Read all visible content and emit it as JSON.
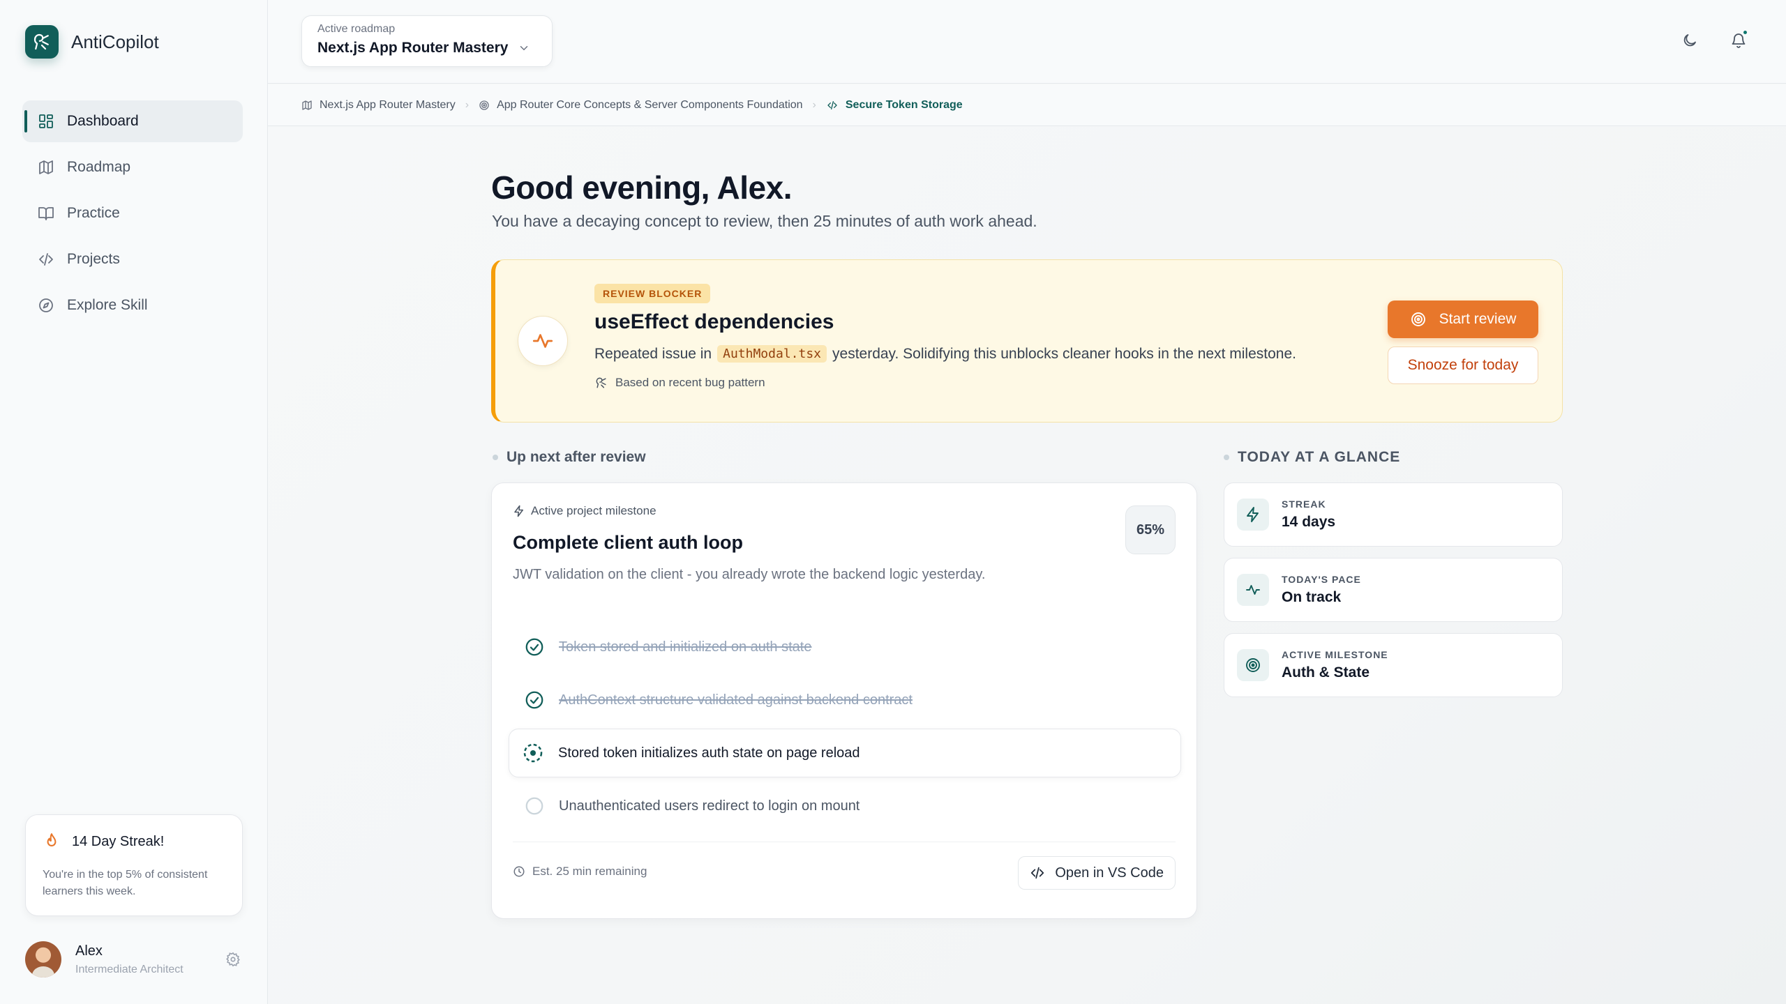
{
  "app": {
    "name": "AntiCopilot"
  },
  "sidebar": {
    "items": [
      {
        "label": "Dashboard",
        "icon": "dashboard-icon",
        "active": true
      },
      {
        "label": "Roadmap",
        "icon": "map-icon"
      },
      {
        "label": "Practice",
        "icon": "book-icon"
      },
      {
        "label": "Projects",
        "icon": "code-icon"
      },
      {
        "label": "Explore Skill",
        "icon": "compass-icon"
      }
    ],
    "streak": {
      "title": "14 Day Streak!",
      "subtitle": "You're in the top 5% of consistent learners this week."
    },
    "user": {
      "name": "Alex",
      "role": "Intermediate Architect"
    }
  },
  "header": {
    "roadmap_label": "Active roadmap",
    "roadmap_value": "Next.js App Router Mastery"
  },
  "breadcrumb": [
    "Next.js App Router Mastery",
    "App Router Core Concepts & Server Components Foundation",
    "Secure Token Storage"
  ],
  "main": {
    "greeting": "Good evening, Alex.",
    "subtitle": "You have a decaying concept to review, then 25 minutes of auth work ahead.",
    "review": {
      "badge": "REVIEW BLOCKER",
      "title": "useEffect dependencies",
      "desc_prefix": "Repeated issue in",
      "desc_code": "AuthModal.tsx",
      "desc_suffix": "yesterday. Solidifying this unblocks cleaner hooks in the next milestone.",
      "note": "Based on recent bug pattern",
      "start_label": "Start review",
      "snooze_label": "Snooze for today"
    },
    "up_next_label": "Up next after review",
    "milestone": {
      "kicker": "Active project milestone",
      "title": "Complete client auth loop",
      "description": "JWT validation on the client - you already wrote the backend logic yesterday.",
      "progress_label": "65%",
      "progress": 0.65,
      "tasks": [
        {
          "label": "Token stored and initialized on auth state",
          "status": "done"
        },
        {
          "label": "AuthContext structure validated against backend contract",
          "status": "done"
        },
        {
          "label": "Stored token initializes auth state on page reload",
          "status": "current"
        },
        {
          "label": "Unauthenticated users redirect to login on mount",
          "status": "todo"
        }
      ],
      "estimate": "Est. 25 min remaining",
      "open_label": "Open in VS Code"
    },
    "glance": {
      "title": "TODAY AT A GLANCE",
      "cards": [
        {
          "label": "STREAK",
          "value": "14 days",
          "icon": "bolt-icon"
        },
        {
          "label": "TODAY'S PACE",
          "value": "On track",
          "icon": "pulse-icon"
        },
        {
          "label": "ACTIVE MILESTONE",
          "value": "Auth & State",
          "icon": "target-icon"
        }
      ]
    }
  },
  "colors": {
    "brand": "#115e59",
    "accent": "#e8772b",
    "warning": "#f59e0b"
  }
}
